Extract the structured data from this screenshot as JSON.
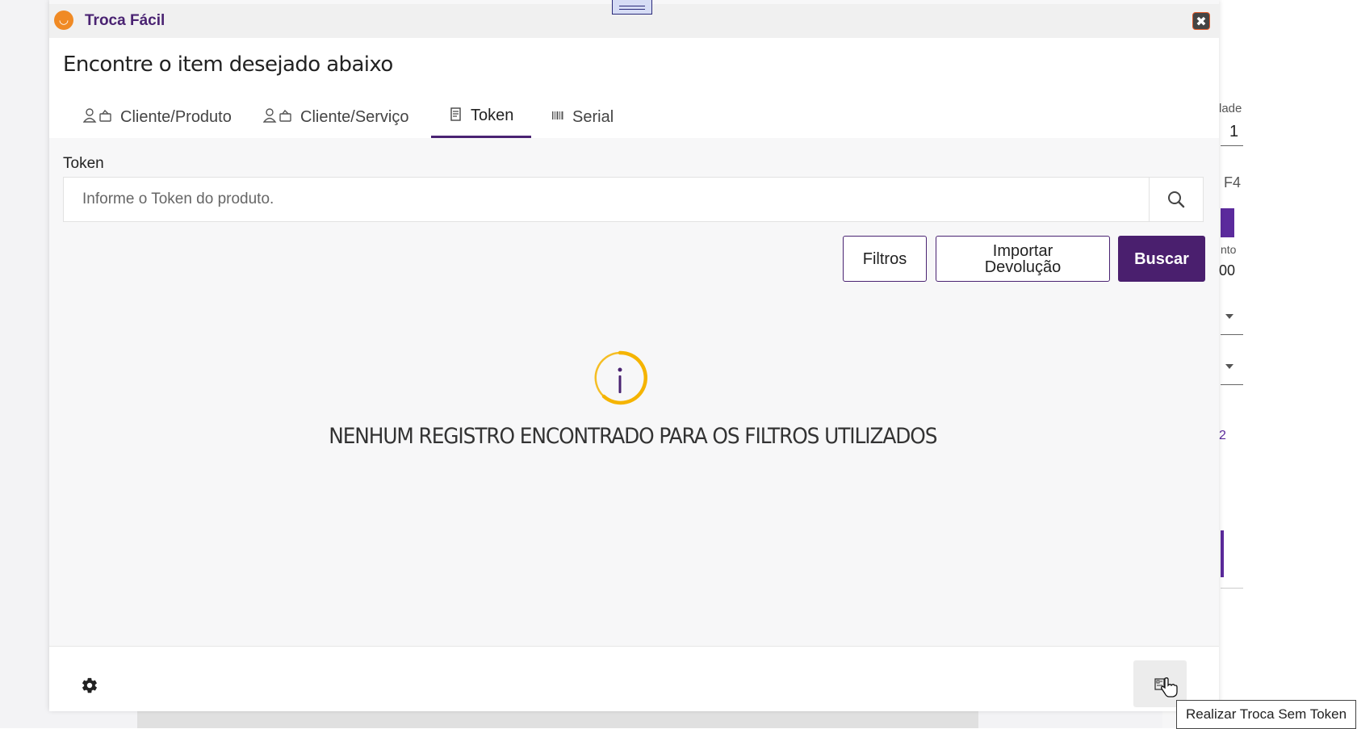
{
  "window": {
    "title": "Troca Fácil",
    "close_label": "✖"
  },
  "header": {
    "heading": "Encontre o item desejado abaixo"
  },
  "tabs": [
    {
      "label": "Cliente/Produto",
      "icon": "user-basket-icon",
      "active": false
    },
    {
      "label": "Cliente/Serviço",
      "icon": "user-basket-icon",
      "active": false
    },
    {
      "label": "Token",
      "icon": "receipt-icon",
      "active": true
    },
    {
      "label": "Serial",
      "icon": "barcode-icon",
      "active": false
    }
  ],
  "token_field": {
    "label": "Token",
    "placeholder": "Informe o Token do produto.",
    "value": ""
  },
  "actions": {
    "filters": "Filtros",
    "import_return": "Importar Devolução",
    "search": "Buscar"
  },
  "empty_state": {
    "message": "NENHUM REGISTRO ENCONTRADO PARA OS FILTROS UTILIZADOS"
  },
  "footer": {
    "tooltip": "Realizar Troca Sem Token"
  },
  "background": {
    "label_quantidade": "lade",
    "value_quantidade": "1",
    "label_f4": "F4",
    "label_desconto": "nto",
    "value_desconto": "00",
    "value_2": "2"
  },
  "colors": {
    "brand": "#4a2372",
    "accent_orange": "#f08a24",
    "primary_button": "#4a1f6e"
  }
}
